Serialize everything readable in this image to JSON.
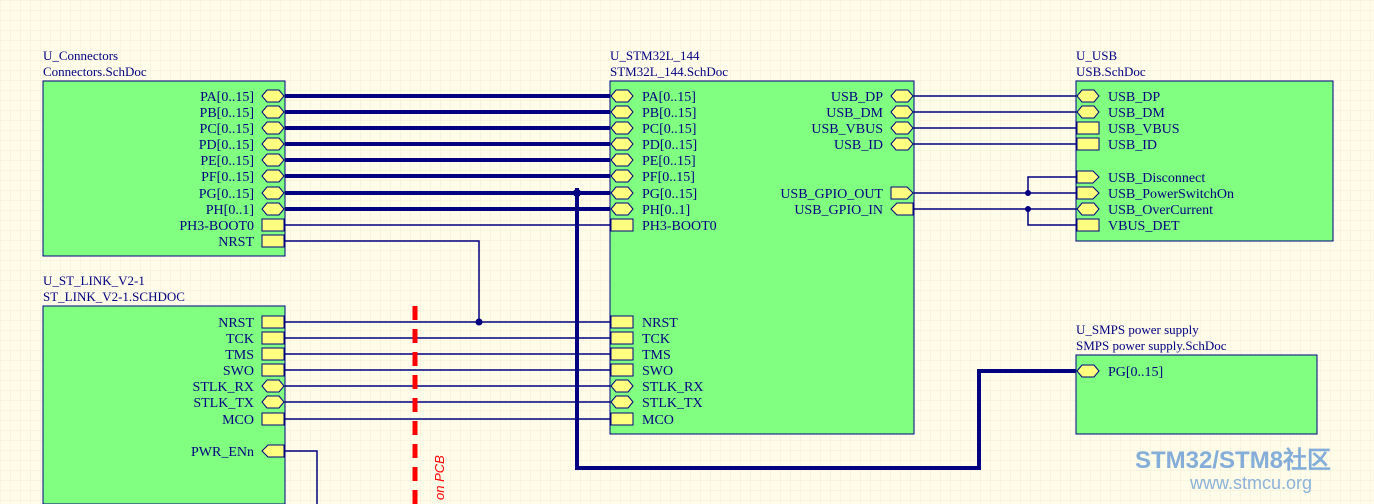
{
  "colors": {
    "background": "#fffcea",
    "grid": "#f1ecd4",
    "block_fill": "#80ff80",
    "port_fill": "#ffff80",
    "wire": "#000080",
    "text": "#000080",
    "pcb_dash": "#ff0000",
    "watermark": "#6f9fd6"
  },
  "sheets": {
    "connectors": {
      "designator": "U_Connectors",
      "file": "Connectors.SchDoc",
      "ports": [
        "PA[0..15]",
        "PB[0..15]",
        "PC[0..15]",
        "PD[0..15]",
        "PE[0..15]",
        "PF[0..15]",
        "PG[0..15]",
        "PH[0..1]",
        "PH3-BOOT0",
        "NRST"
      ]
    },
    "st_link": {
      "designator": "U_ST_LINK_V2-1",
      "file": "ST_LINK_V2-1.SCHDOC",
      "ports": [
        "NRST",
        "TCK",
        "TMS",
        "SWO",
        "STLK_RX",
        "STLK_TX",
        "MCO",
        "PWR_ENn"
      ]
    },
    "stm32": {
      "designator": "U_STM32L_144",
      "file": "STM32L_144.SchDoc",
      "left_ports": [
        "PA[0..15]",
        "PB[0..15]",
        "PC[0..15]",
        "PD[0..15]",
        "PE[0..15]",
        "PF[0..15]",
        "PG[0..15]",
        "PH[0..1]",
        "PH3-BOOT0",
        "NRST",
        "TCK",
        "TMS",
        "SWO",
        "STLK_RX",
        "STLK_TX",
        "MCO"
      ],
      "right_ports": [
        "USB_DP",
        "USB_DM",
        "USB_VBUS",
        "USB_ID",
        "USB_GPIO_OUT",
        "USB_GPIO_IN"
      ]
    },
    "usb": {
      "designator": "U_USB",
      "file": "USB.SchDoc",
      "ports": [
        "USB_DP",
        "USB_DM",
        "USB_VBUS",
        "USB_ID",
        "USB_Disconnect",
        "USB_PowerSwitchOn",
        "USB_OverCurrent",
        "VBUS_DET"
      ]
    },
    "smps": {
      "designator": "U_SMPS power supply",
      "file": "SMPS power supply.SchDoc",
      "ports": [
        "PG[0..15]"
      ]
    }
  },
  "pcb_label": "on PCB",
  "watermark": {
    "line1_a": "STM32",
    "line1_b": "/",
    "line1_c": "STM8",
    "line1_d": "社区",
    "line2": "www.stmcu.org"
  }
}
